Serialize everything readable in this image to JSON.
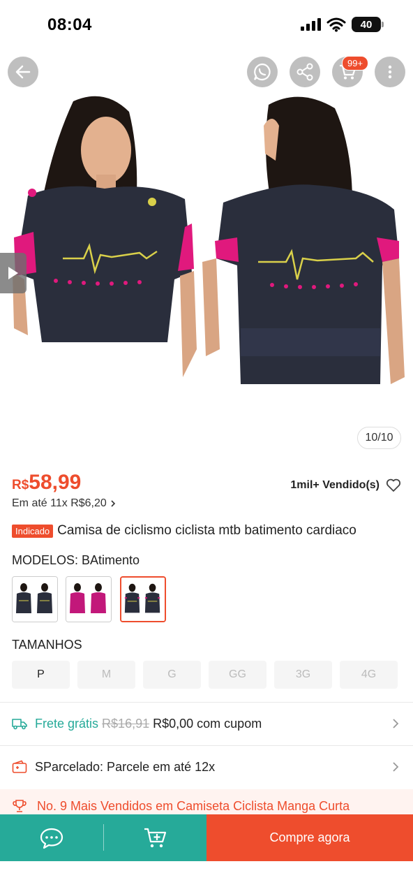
{
  "status_bar": {
    "time": "08:04",
    "battery": "40"
  },
  "header": {
    "cart_badge": "99+"
  },
  "gallery": {
    "counter": "10/10"
  },
  "product": {
    "price_currency": "R$",
    "price_value": "58,99",
    "installments": "Em até 11x R$6,20",
    "sold": "1mil+ Vendido(s)",
    "badge": "Indicado",
    "title": "Camisa de ciclismo ciclista mtb batimento cardiaco"
  },
  "variants": {
    "label": "MODELOS: ",
    "selected_value": "BAtimento",
    "options_count": 3,
    "selected_index": 2
  },
  "sizes": {
    "label": "TAMANHOS",
    "options": [
      {
        "label": "P",
        "available": true
      },
      {
        "label": "M",
        "available": false
      },
      {
        "label": "G",
        "available": false
      },
      {
        "label": "GG",
        "available": false
      },
      {
        "label": "3G",
        "available": false
      },
      {
        "label": "4G",
        "available": false
      }
    ]
  },
  "shipping": {
    "free_label": "Frete grátis",
    "old_price": "R$16,91",
    "new_price": "R$0,00 com cupom"
  },
  "installment_plan": {
    "label": "SParcelado: Parcele em até 12x"
  },
  "bestseller": {
    "label": "No. 9 Mais Vendidos em Camiseta Ciclista Manga Curta"
  },
  "bottom_bar": {
    "buy_label": "Compre agora"
  },
  "colors": {
    "accent": "#ee4d2d",
    "teal": "#26aa99"
  }
}
